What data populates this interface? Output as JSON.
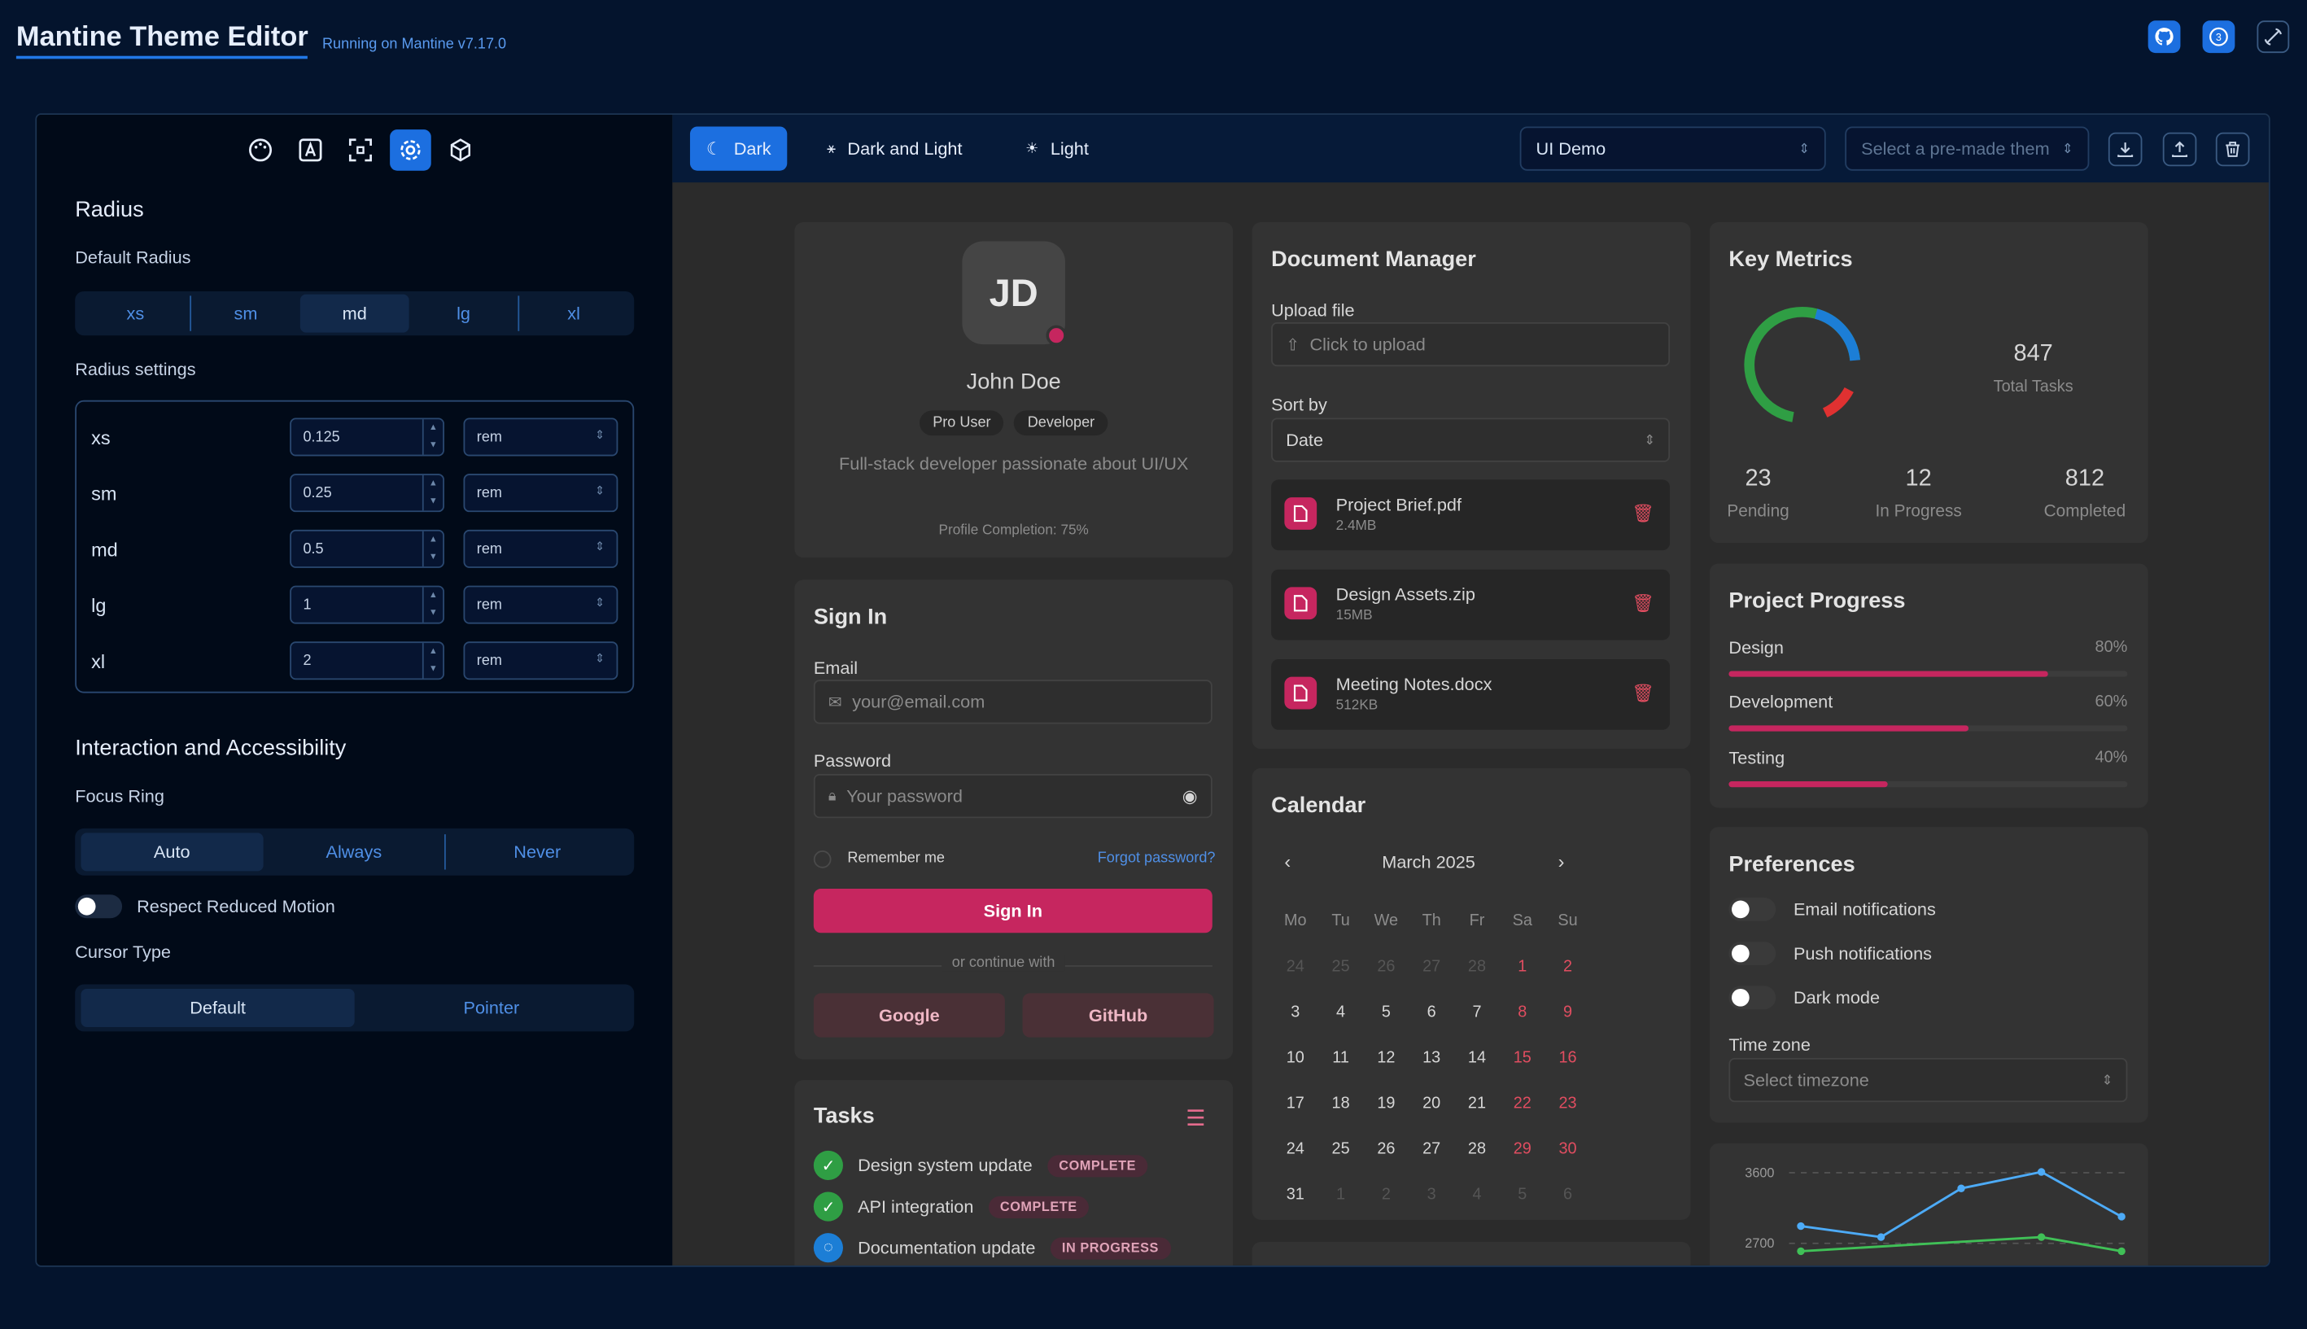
{
  "header": {
    "title": "Mantine Theme Editor",
    "subtitle": "Running on Mantine v7.17.0",
    "icons": [
      "github-icon",
      "help-icon",
      "theme-toggle-icon"
    ]
  },
  "sidebar": {
    "nav_icons": [
      "palette-icon",
      "typography-icon",
      "spacing-icon",
      "settings-icon",
      "box-icon"
    ],
    "active_nav": "settings-icon",
    "radius": {
      "title": "Radius",
      "default_label": "Default Radius",
      "options": [
        "xs",
        "sm",
        "md",
        "lg",
        "xl"
      ],
      "selected": "md",
      "settings_label": "Radius settings",
      "rows": [
        {
          "name": "xs",
          "value": "0.125",
          "unit": "rem"
        },
        {
          "name": "sm",
          "value": "0.25",
          "unit": "rem"
        },
        {
          "name": "md",
          "value": "0.5",
          "unit": "rem"
        },
        {
          "name": "lg",
          "value": "1",
          "unit": "rem"
        },
        {
          "name": "xl",
          "value": "2",
          "unit": "rem"
        }
      ]
    },
    "interaction": {
      "title": "Interaction and Accessibility",
      "focus_label": "Focus Ring",
      "focus_options": [
        "Auto",
        "Always",
        "Never"
      ],
      "focus_selected": "Auto",
      "reduced_motion_label": "Respect Reduced Motion",
      "reduced_motion_on": false,
      "cursor_label": "Cursor Type",
      "cursor_options": [
        "Default",
        "Pointer"
      ],
      "cursor_selected": "Default"
    }
  },
  "toolbar": {
    "modes": [
      "Dark",
      "Dark and Light",
      "Light"
    ],
    "selected_mode": "Dark",
    "demo_select": "UI Demo",
    "theme_placeholder": "Select a pre-made theme",
    "action_icons": [
      "download-icon",
      "upload-icon",
      "trash-icon"
    ]
  },
  "profile": {
    "initials": "JD",
    "name": "John Doe",
    "badges": [
      "Pro User",
      "Developer"
    ],
    "bio": "Full-stack developer passionate about UI/UX",
    "completion": "Profile Completion: 75%"
  },
  "signin": {
    "title": "Sign In",
    "email_label": "Email",
    "email_placeholder": "your@email.com",
    "password_label": "Password",
    "password_placeholder": "Your password",
    "remember": "Remember me",
    "forgot": "Forgot password?",
    "submit": "Sign In",
    "divider": "or continue with",
    "google": "Google",
    "github": "GitHub"
  },
  "tasks": {
    "title": "Tasks",
    "items": [
      {
        "label": "Design system update",
        "status": "COMPLETE"
      },
      {
        "label": "API integration",
        "status": "COMPLETE"
      },
      {
        "label": "Documentation update",
        "status": "IN PROGRESS"
      }
    ]
  },
  "documents": {
    "title": "Document Manager",
    "upload_label": "Upload file",
    "upload_placeholder": "Click to upload",
    "sort_label": "Sort by",
    "sort_value": "Date",
    "files": [
      {
        "name": "Project Brief.pdf",
        "size": "2.4MB"
      },
      {
        "name": "Design Assets.zip",
        "size": "15MB"
      },
      {
        "name": "Meeting Notes.docx",
        "size": "512KB"
      }
    ]
  },
  "calendar": {
    "title": "Calendar",
    "month": "March 2025",
    "weekdays": [
      "Mo",
      "Tu",
      "We",
      "Th",
      "Fr",
      "Sa",
      "Su"
    ],
    "weeks": [
      [
        "24",
        "25",
        "26",
        "27",
        "28",
        "1",
        "2"
      ],
      [
        "3",
        "4",
        "5",
        "6",
        "7",
        "8",
        "9"
      ],
      [
        "10",
        "11",
        "12",
        "13",
        "14",
        "15",
        "16"
      ],
      [
        "17",
        "18",
        "19",
        "20",
        "21",
        "22",
        "23"
      ],
      [
        "24",
        "25",
        "26",
        "27",
        "28",
        "29",
        "30"
      ],
      [
        "31",
        "1",
        "2",
        "3",
        "4",
        "5",
        "6"
      ]
    ]
  },
  "metrics": {
    "title": "Key Metrics",
    "total": "847",
    "total_label": "Total Tasks",
    "stats": [
      {
        "value": "23",
        "label": "Pending"
      },
      {
        "value": "12",
        "label": "In Progress"
      },
      {
        "value": "812",
        "label": "Completed"
      }
    ],
    "ring_colors": [
      "#2f9e44",
      "#1c7ed6",
      "#e03131"
    ]
  },
  "progress": {
    "title": "Project Progress",
    "items": [
      {
        "label": "Design",
        "value": "80%",
        "fraction": 0.8
      },
      {
        "label": "Development",
        "value": "60%",
        "fraction": 0.6
      },
      {
        "label": "Testing",
        "value": "40%",
        "fraction": 0.4
      }
    ]
  },
  "preferences": {
    "title": "Preferences",
    "toggles": [
      "Email notifications",
      "Push notifications",
      "Dark mode"
    ],
    "timezone_label": "Time zone",
    "timezone_placeholder": "Select timezone"
  },
  "chart_data": {
    "type": "line",
    "yticks": [
      "3600",
      "2700"
    ],
    "series": [
      {
        "color": "#4dabf7",
        "values": [
          2920,
          2780,
          3400,
          3610,
          3040
        ]
      },
      {
        "color": "#40c057",
        "values": [
          2600,
          null,
          null,
          2780,
          2600
        ]
      }
    ],
    "ylim": [
      2400,
      3800
    ]
  },
  "colors": {
    "accent": "#1c6fe0",
    "pink": "#c6265f"
  }
}
